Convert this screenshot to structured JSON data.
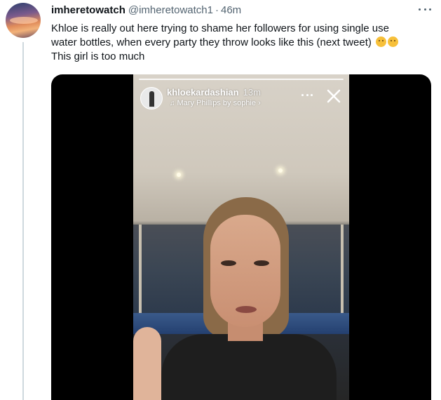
{
  "tweet": {
    "display_name": "imheretowatch",
    "handle": "@imheretowatch1",
    "separator": "·",
    "time": "46m",
    "text_line1": "Khloe is really out here trying to shame her followers for using single use",
    "text_line2": "water bottles, when every party they throw looks like this (next tweet)",
    "text_line3": "This girl is too much",
    "emojis": [
      "worried-face-emoji",
      "worried-face-emoji"
    ]
  },
  "story": {
    "username": "khloekardashian",
    "time": "13m",
    "music": "Mary Phillips by sophie",
    "music_chevron": "›"
  },
  "colors": {
    "text_primary": "#0f1419",
    "text_secondary": "#536471",
    "thread_line": "#cfd9de",
    "media_bg": "#000000"
  }
}
